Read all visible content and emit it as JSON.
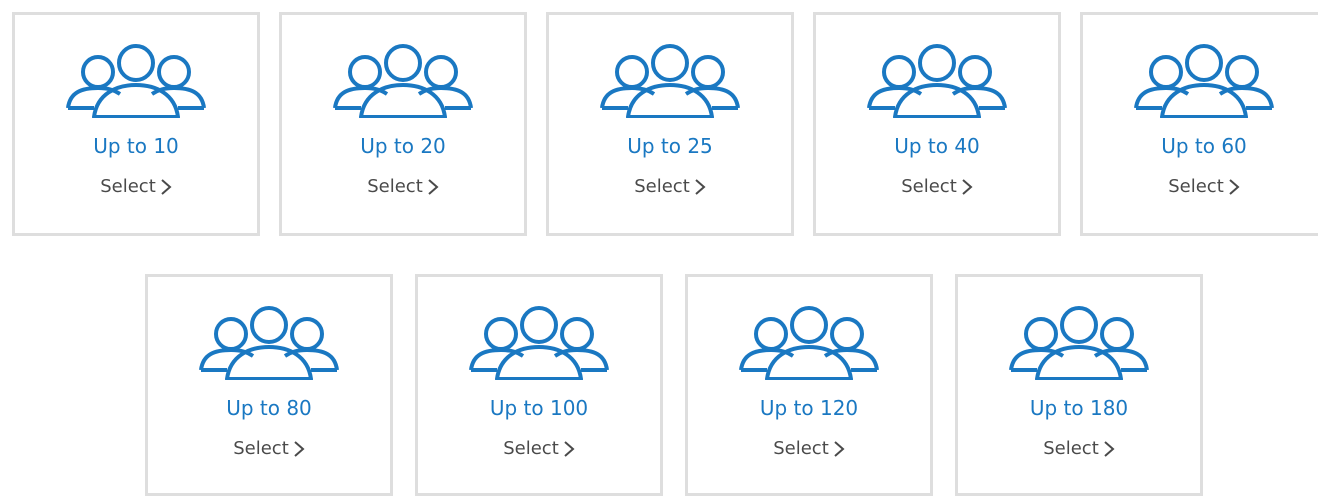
{
  "accent_color": "#1a78c2",
  "icon_name": "users-group-icon",
  "chevron_icon_name": "chevron-right-icon",
  "options": [
    {
      "label": "Up to 10",
      "action": "Select"
    },
    {
      "label": "Up to 20",
      "action": "Select"
    },
    {
      "label": "Up to 25",
      "action": "Select"
    },
    {
      "label": "Up to 40",
      "action": "Select"
    },
    {
      "label": "Up to 60",
      "action": "Select"
    },
    {
      "label": "Up to 80",
      "action": "Select"
    },
    {
      "label": "Up to 100",
      "action": "Select"
    },
    {
      "label": "Up to 120",
      "action": "Select"
    },
    {
      "label": "Up to 180",
      "action": "Select"
    }
  ]
}
